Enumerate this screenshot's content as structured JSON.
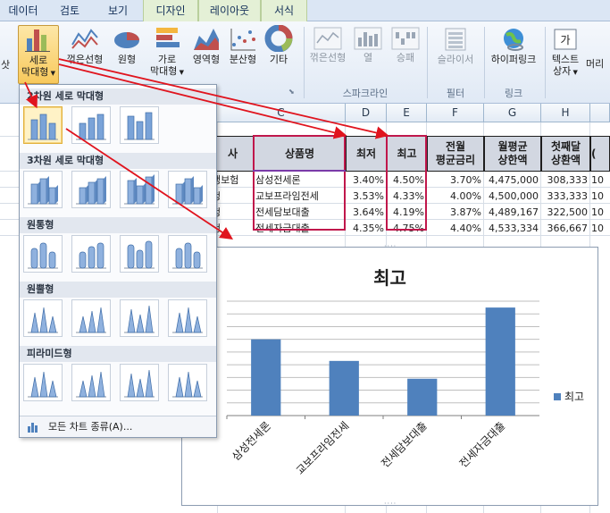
{
  "tabs": [
    "데이터",
    "검토",
    "보기",
    "디자인",
    "레이아웃",
    "서식"
  ],
  "ribbon": {
    "left_clip": "삿",
    "buttons": [
      {
        "id": "column",
        "label1": "세로",
        "label2": "막대형"
      },
      {
        "id": "line",
        "label1": "꺾은선형",
        "label2": ""
      },
      {
        "id": "pie",
        "label1": "원형",
        "label2": ""
      },
      {
        "id": "bar",
        "label1": "가로",
        "label2": "막대형"
      },
      {
        "id": "area",
        "label1": "영역형",
        "label2": ""
      },
      {
        "id": "scatter",
        "label1": "분산형",
        "label2": ""
      },
      {
        "id": "other",
        "label1": "기타",
        "label2": ""
      },
      {
        "id": "spark-line",
        "label1": "꺾은선형",
        "label2": ""
      },
      {
        "id": "spark-column",
        "label1": "열",
        "label2": ""
      },
      {
        "id": "spark-winloss",
        "label1": "승패",
        "label2": ""
      },
      {
        "id": "slicer",
        "label1": "슬라이서",
        "label2": ""
      },
      {
        "id": "hyperlink",
        "label1": "하이퍼링크",
        "label2": ""
      },
      {
        "id": "textbox",
        "label1": "텍스트",
        "label2": "상자"
      },
      {
        "id": "header",
        "label1": "머리",
        "label2": ""
      }
    ],
    "groups": [
      "스파크라인",
      "필터",
      "링크"
    ]
  },
  "gallery": {
    "sections": [
      "2차원 세로 막대형",
      "3차원 세로 막대형",
      "원통형",
      "원뿔형",
      "피라미드형"
    ],
    "footer": "모든 차트 종류(A)..."
  },
  "sheet": {
    "columns": [
      "C",
      "D",
      "E",
      "F",
      "G",
      "H"
    ],
    "header": {
      "b": "사",
      "c": "상품명",
      "d": "최저",
      "e": "최고",
      "f": "전월\n평균금리",
      "g": "월평균\n상한액",
      "h": "첫째달\n상환액",
      "i": "("
    },
    "rows": [
      {
        "b": "생보험",
        "c": "삼성전세론",
        "d": "3.40%",
        "e": "4.50%",
        "f": "3.70%",
        "g": "4,475,000",
        "h": "308,333",
        "i": "10"
      },
      {
        "b": "헝",
        "c": "교보프라임전세",
        "d": "3.53%",
        "e": "4.33%",
        "f": "4.00%",
        "g": "4,500,000",
        "h": "333,333",
        "i": "10"
      },
      {
        "b": "헝",
        "c": "전세담보대출",
        "d": "3.64%",
        "e": "4.19%",
        "f": "3.87%",
        "g": "4,489,167",
        "h": "322,500",
        "i": "10"
      },
      {
        "b": "헝",
        "c": "전세자금대출",
        "d": "4.35%",
        "e": "4.75%",
        "f": "4.40%",
        "g": "4,533,334",
        "h": "366,667",
        "i": "10"
      }
    ]
  },
  "chart_data": {
    "type": "bar",
    "title": "최고",
    "categories": [
      "삼성전세론",
      "교보프라임전세",
      "전세담보대출",
      "전세자금대출"
    ],
    "series": [
      {
        "name": "최고",
        "values": [
          4.5,
          4.33,
          4.19,
          4.75
        ]
      }
    ],
    "ylim": [
      3.9,
      4.8
    ],
    "grid": true,
    "legend": "right"
  },
  "colors": {
    "accent_red": "#c0174b",
    "bar": "#4f81bd",
    "ribbon": "#e0e9f5"
  }
}
